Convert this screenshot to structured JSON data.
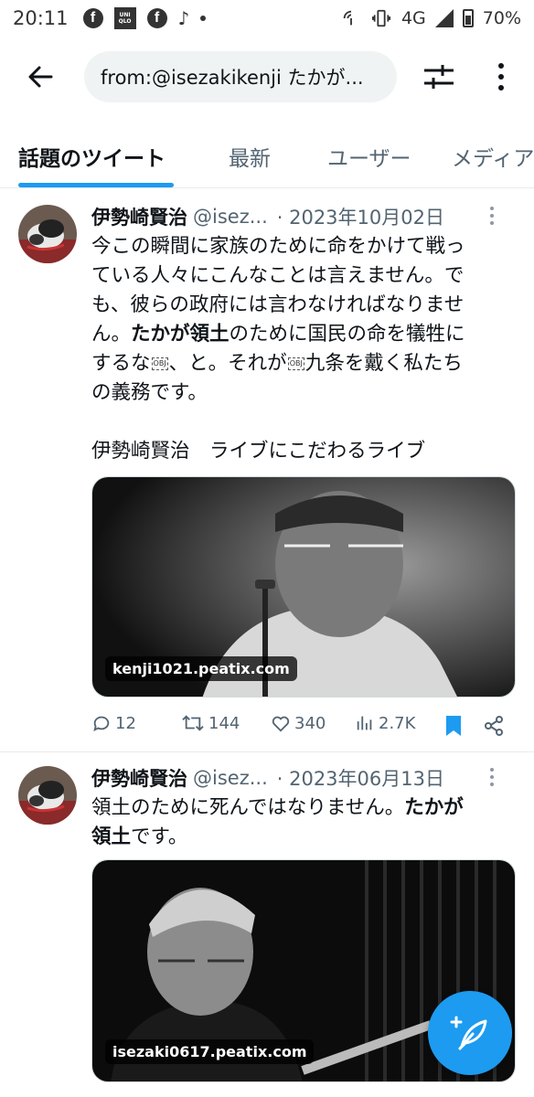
{
  "status_bar": {
    "time": "20:11",
    "network": "4G",
    "battery": "70%",
    "app_icons": [
      "facebook-icon",
      "uniqlo-icon",
      "facebook-icon",
      "tiktok-icon"
    ],
    "uniqlo_label": "UNI QLO"
  },
  "search": {
    "query": "from:@isezakikenji たかが..."
  },
  "tabs": [
    {
      "label": "話題のツイート",
      "active": true
    },
    {
      "label": "最新",
      "active": false
    },
    {
      "label": "ユーザー",
      "active": false
    },
    {
      "label": "メディア",
      "active": false
    }
  ],
  "tweets": [
    {
      "name": "伊勢崎賢治",
      "handle": "@isez...",
      "date": "· 2023年10月02日",
      "text_lines": [
        "今この瞬間に家族のために命をかけて戦っ",
        "ている人々にこんなことは言えません。で",
        "も、彼らの政府には言わなければなりませ"
      ],
      "line4_a": "ん。",
      "line4_bold": "たかが領土",
      "line4_b": "のために国民の命を犠牲に",
      "line5_a": "するな",
      "line5_b": "、と。それが",
      "line5_c": "九条を戴く私たち",
      "line6": "の義務です。",
      "obj_glyph": "OBJ",
      "line8": "伊勢崎賢治　ライブにこだわるライブ",
      "media_label": "kenji1021.peatix.com",
      "replies": "12",
      "retweets": "144",
      "likes": "340",
      "views": "2.7K"
    },
    {
      "name": "伊勢崎賢治",
      "handle": "@isez...",
      "date": "· 2023年06月13日",
      "line1_a": "領土のために死んではなりません。",
      "line1_bold": "たかが",
      "line2_bold": "領土",
      "line2_b": "です。",
      "media_label": "isezaki0617.peatix.com"
    }
  ],
  "colors": {
    "accent": "#1d9bf0",
    "text": "#0f1419",
    "muted": "#536471"
  }
}
